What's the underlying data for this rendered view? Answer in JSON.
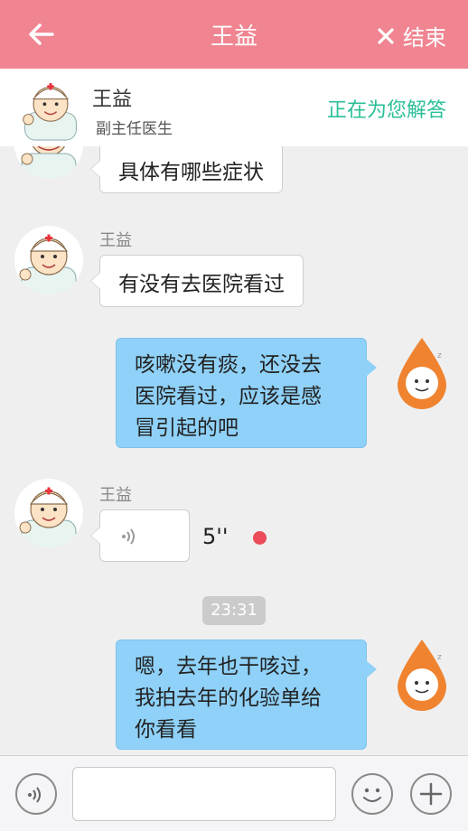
{
  "nav": {
    "title": "王益",
    "end_label": "结束"
  },
  "doctor": {
    "name": "王益",
    "rank": "副主任医生",
    "status": "正在为您解答"
  },
  "messages": {
    "m1": {
      "text": "具体有哪些症状"
    },
    "m2": {
      "sender": "王益",
      "text": "有没有去医院看过"
    },
    "m3": {
      "lines": [
        "咳嗽没有痰，还没去",
        "医院看过，应该是感",
        "冒引起的吧"
      ]
    },
    "m4": {
      "sender": "王益",
      "duration": "5''"
    },
    "m5": {
      "time": "23:31"
    },
    "m6": {
      "lines": [
        "嗯，去年也干咳过，",
        "我拍去年的化验单给",
        "你看看"
      ]
    }
  },
  "colors": {
    "nav_bg": "#f08591",
    "status": "#2bbf98",
    "user_bubble": "#8fd1f8",
    "unread_dot": "#ec4b5a"
  },
  "icons": [
    "back-arrow-icon",
    "close-icon",
    "doctor-avatar",
    "user-avatar",
    "voice-wave-icon",
    "emoji-icon",
    "plus-icon"
  ]
}
